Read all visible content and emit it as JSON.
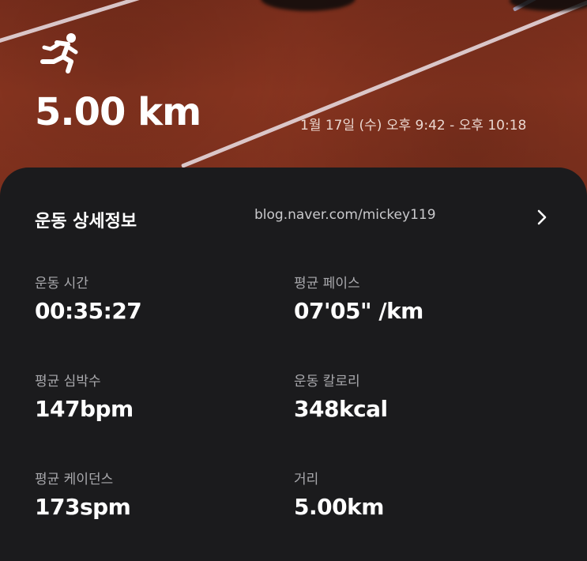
{
  "hero": {
    "distance": "5.00 km",
    "time_range": "1월 17일 (수) 오후 9:42 - 오후 10:18",
    "icon": "running-person-icon",
    "colors": {
      "track": "#8a3520",
      "lane_line": "#ebe1e6"
    }
  },
  "details": {
    "title": "운동 상세정보",
    "watermark": "blog.naver.com/mickey119",
    "chevron_icon": "chevron-right-icon",
    "stats": [
      {
        "label": "운동 시간",
        "value": "00:35:27"
      },
      {
        "label": "평균 페이스",
        "value": "07'05\" /km"
      },
      {
        "label": "평균 심박수",
        "value": "147bpm"
      },
      {
        "label": "운동 칼로리",
        "value": "348kcal"
      },
      {
        "label": "평균 케이던스",
        "value": "173spm"
      },
      {
        "label": "거리",
        "value": "5.00km"
      }
    ],
    "colors": {
      "card_bg": "#1b1b1d",
      "label": "#a9a9ad",
      "value": "#ffffff"
    }
  }
}
